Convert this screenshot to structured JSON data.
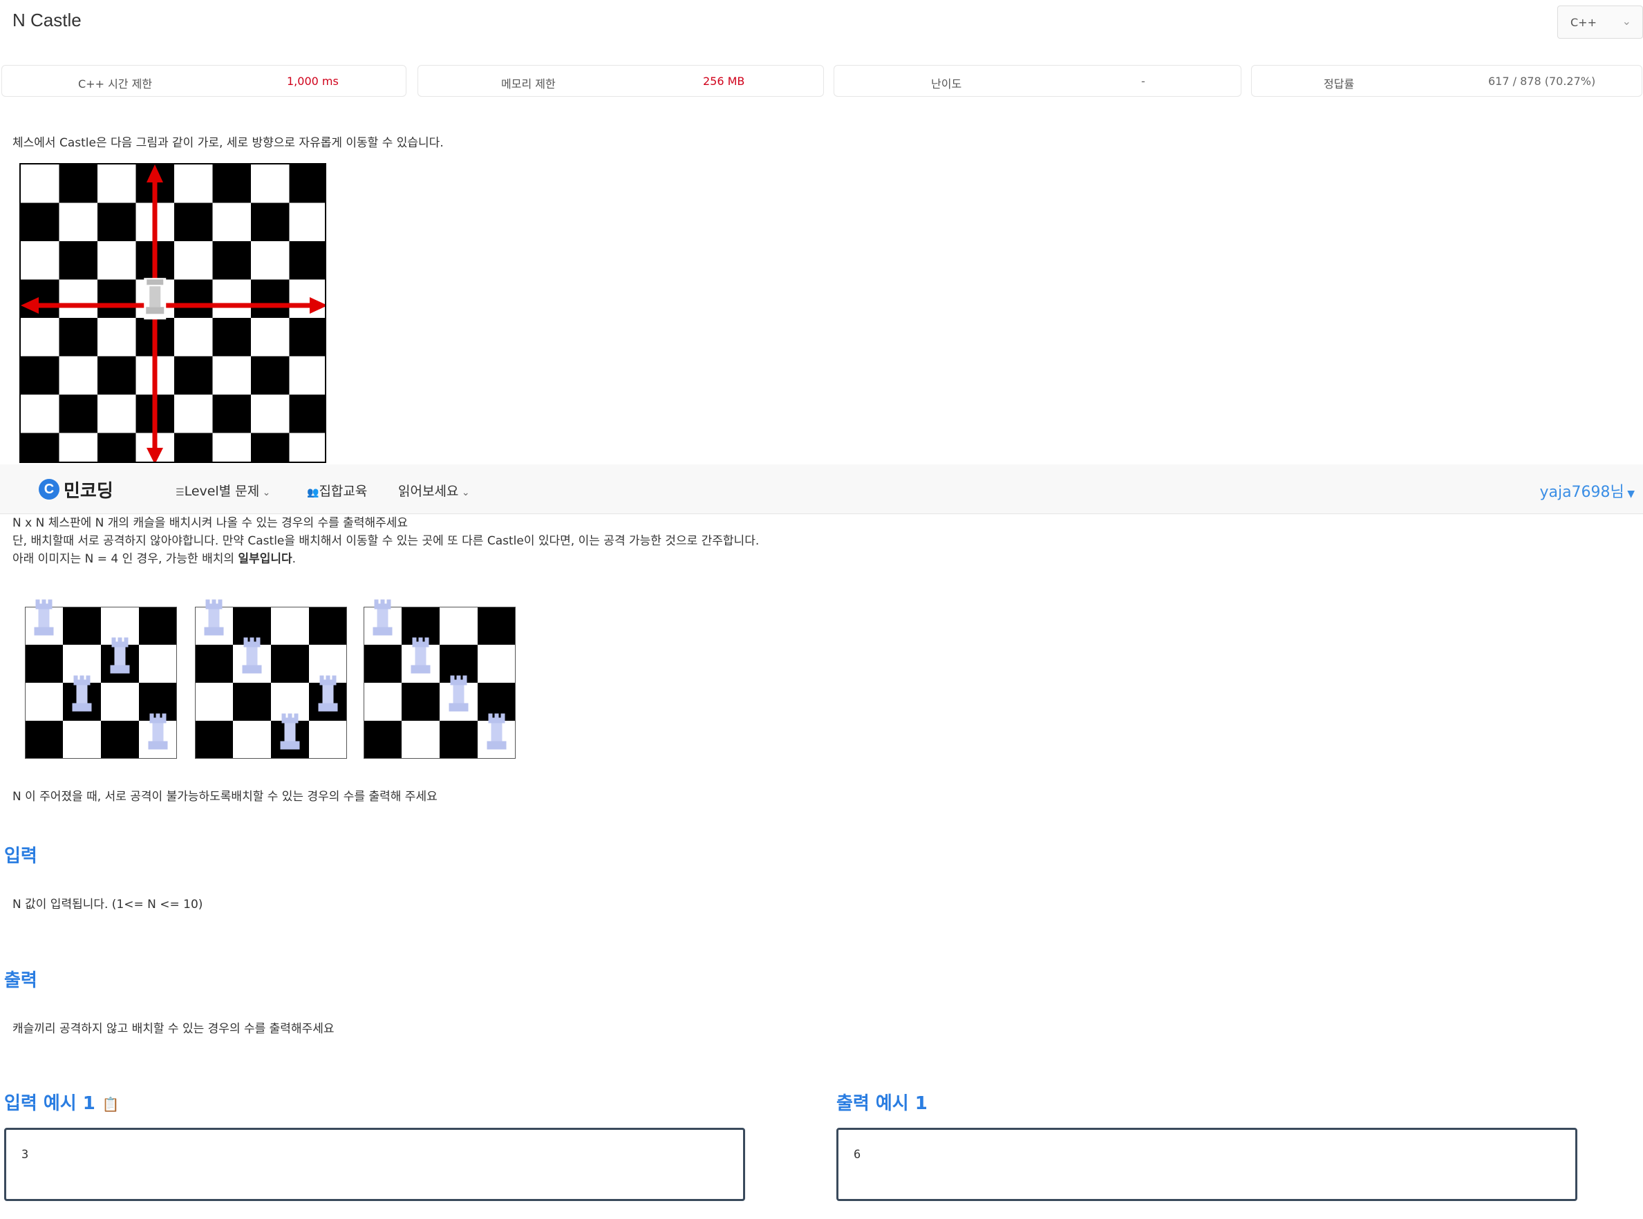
{
  "header": {
    "title": "N Castle",
    "language_select": "C++"
  },
  "stats": [
    {
      "label": "C++ 시간 제한",
      "value": "1,000 ms"
    },
    {
      "label": "메모리 제한",
      "value": "256 MB"
    },
    {
      "label": "난이도",
      "value": "-"
    },
    {
      "label": "정답률",
      "value": "617 / 878 (70.27%)"
    }
  ],
  "problem": {
    "intro": "체스에서  Castle은 다음 그림과 같이 가로, 세로 방향으로 자유롭게 이동할 수 있습니다.",
    "line1": "N x N 체스판에 N 개의 캐슬을 배치시켜 나올 수 있는 경우의 수를 출력해주세요",
    "line2": "단, 배치할때 서로 공격하지 않아야합니다. 만약 Castle을 배치해서 이동할 수 있는 곳에 또 다른 Castle이 있다면, 이는 공격 가능한 것으로 간주합니다.",
    "line3_prefix": "아래 이미지는 N = 4 인 경우, 가능한 배치의 ",
    "line3_bold": "일부입니다",
    "line3_suffix": ".",
    "summary": "N 이 주어졌을 때, 서로 공격이 불가능하도록배치할 수 있는 경우의 수를 출력해 주세요"
  },
  "navbar": {
    "logo_mark": "C",
    "logo_text": "민코딩",
    "menu_level": "Level별 문제",
    "menu_group": "집합교육",
    "menu_read": "읽어보세요",
    "user": "yaja7698님"
  },
  "input_section": {
    "title": "입력",
    "desc": "N 값이 입력됩니다. (1<= N <= 10)"
  },
  "output_section": {
    "title": "출력",
    "desc": "캐슬끼리 공격하지 않고 배치할 수 있는 경우의 수를 출력해주세요"
  },
  "samples": {
    "input_title": "입력 예시 1",
    "output_title": "출력 예시 1",
    "input_value": "3",
    "output_value": "6"
  },
  "icons": {
    "clipboard": "clipboard-icon",
    "chevron": "chevron-down-icon",
    "list": "list-icon",
    "people": "people-icon",
    "rook": "rook-icon"
  },
  "colors": {
    "accent": "#2a7de1",
    "stat_value": "#d0021b",
    "arrow": "#e00000"
  },
  "boards": {
    "example_castle_square": [
      3,
      3
    ],
    "placements_n4": [
      [
        0,
        2,
        1,
        3
      ],
      [
        0,
        1,
        3,
        2
      ],
      [
        0,
        1,
        2,
        3
      ]
    ]
  }
}
